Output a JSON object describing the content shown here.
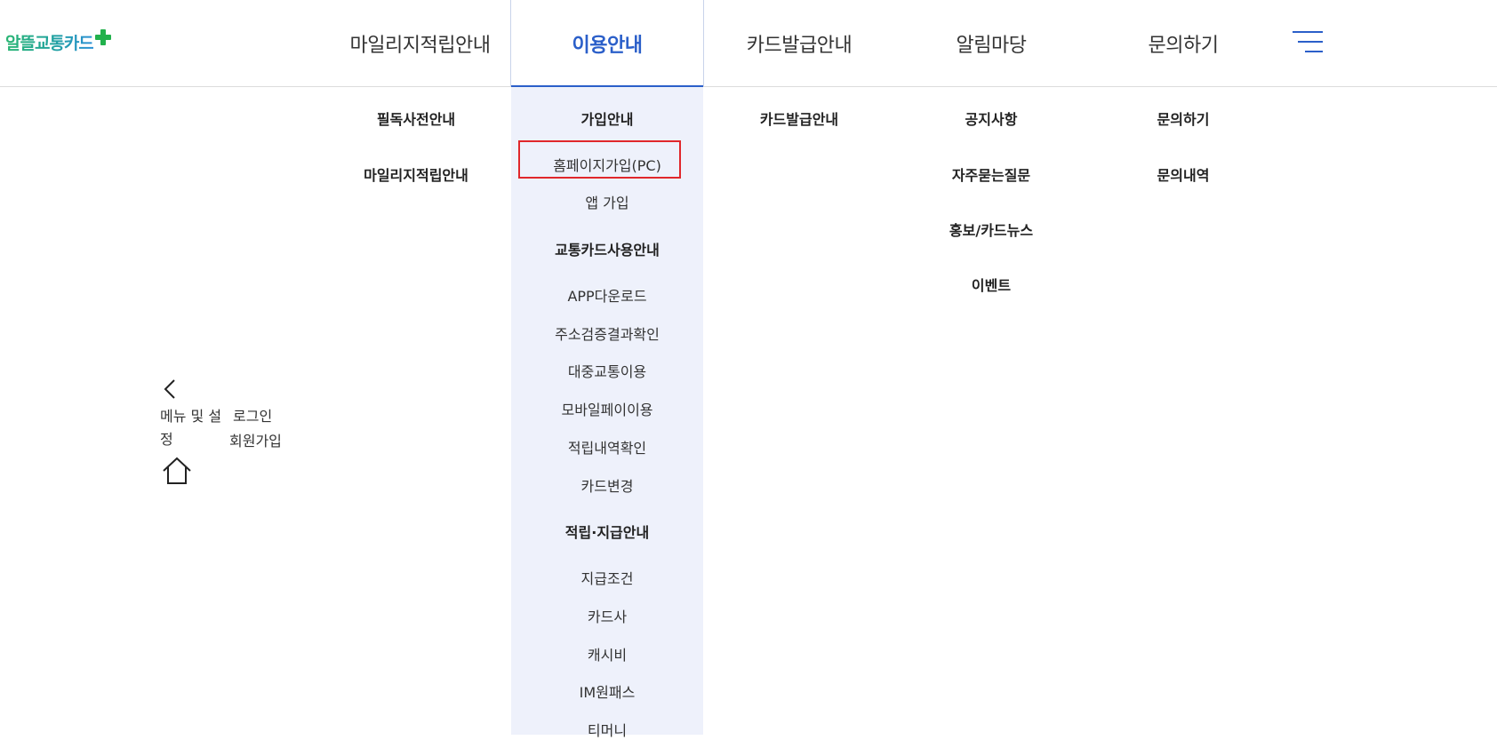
{
  "logo": {
    "text": "알뜰교통카드"
  },
  "gnb": [
    {
      "label": "마일리지적립안내"
    },
    {
      "label": "이용안내"
    },
    {
      "label": "카드발급안내"
    },
    {
      "label": "알림마당"
    },
    {
      "label": "문의하기"
    }
  ],
  "menu": {
    "col1": [
      "필독사전안내",
      "마일리지적립안내"
    ],
    "col2": {
      "g1": "가입안내",
      "g1_items": [
        "홈페이지가입(PC)",
        "앱 가입"
      ],
      "g2": "교통카드사용안내",
      "g2_items": [
        "APP다운로드",
        "주소검증결과확인",
        "대중교통이용",
        "모바일페이이용",
        "적립내역확인",
        "카드변경"
      ],
      "g3": "적립·지급안내",
      "g3_items": [
        "지급조건",
        "카드사",
        "캐시비",
        "IM원패스",
        "티머니"
      ]
    },
    "col3": [
      "카드발급안내"
    ],
    "col4": [
      "공지사항",
      "자주묻는질문",
      "홍보/카드뉴스",
      "이벤트"
    ],
    "col5": [
      "문의하기",
      "문의내역"
    ]
  },
  "side": {
    "menu_label_1": "메뉴 및 설",
    "menu_label_2": "정",
    "login": "로그인",
    "join": "회원가입"
  },
  "colors": {
    "accent": "#2b5fc9",
    "highlight": "#e0272b",
    "active_bg": "#eef1fb"
  }
}
